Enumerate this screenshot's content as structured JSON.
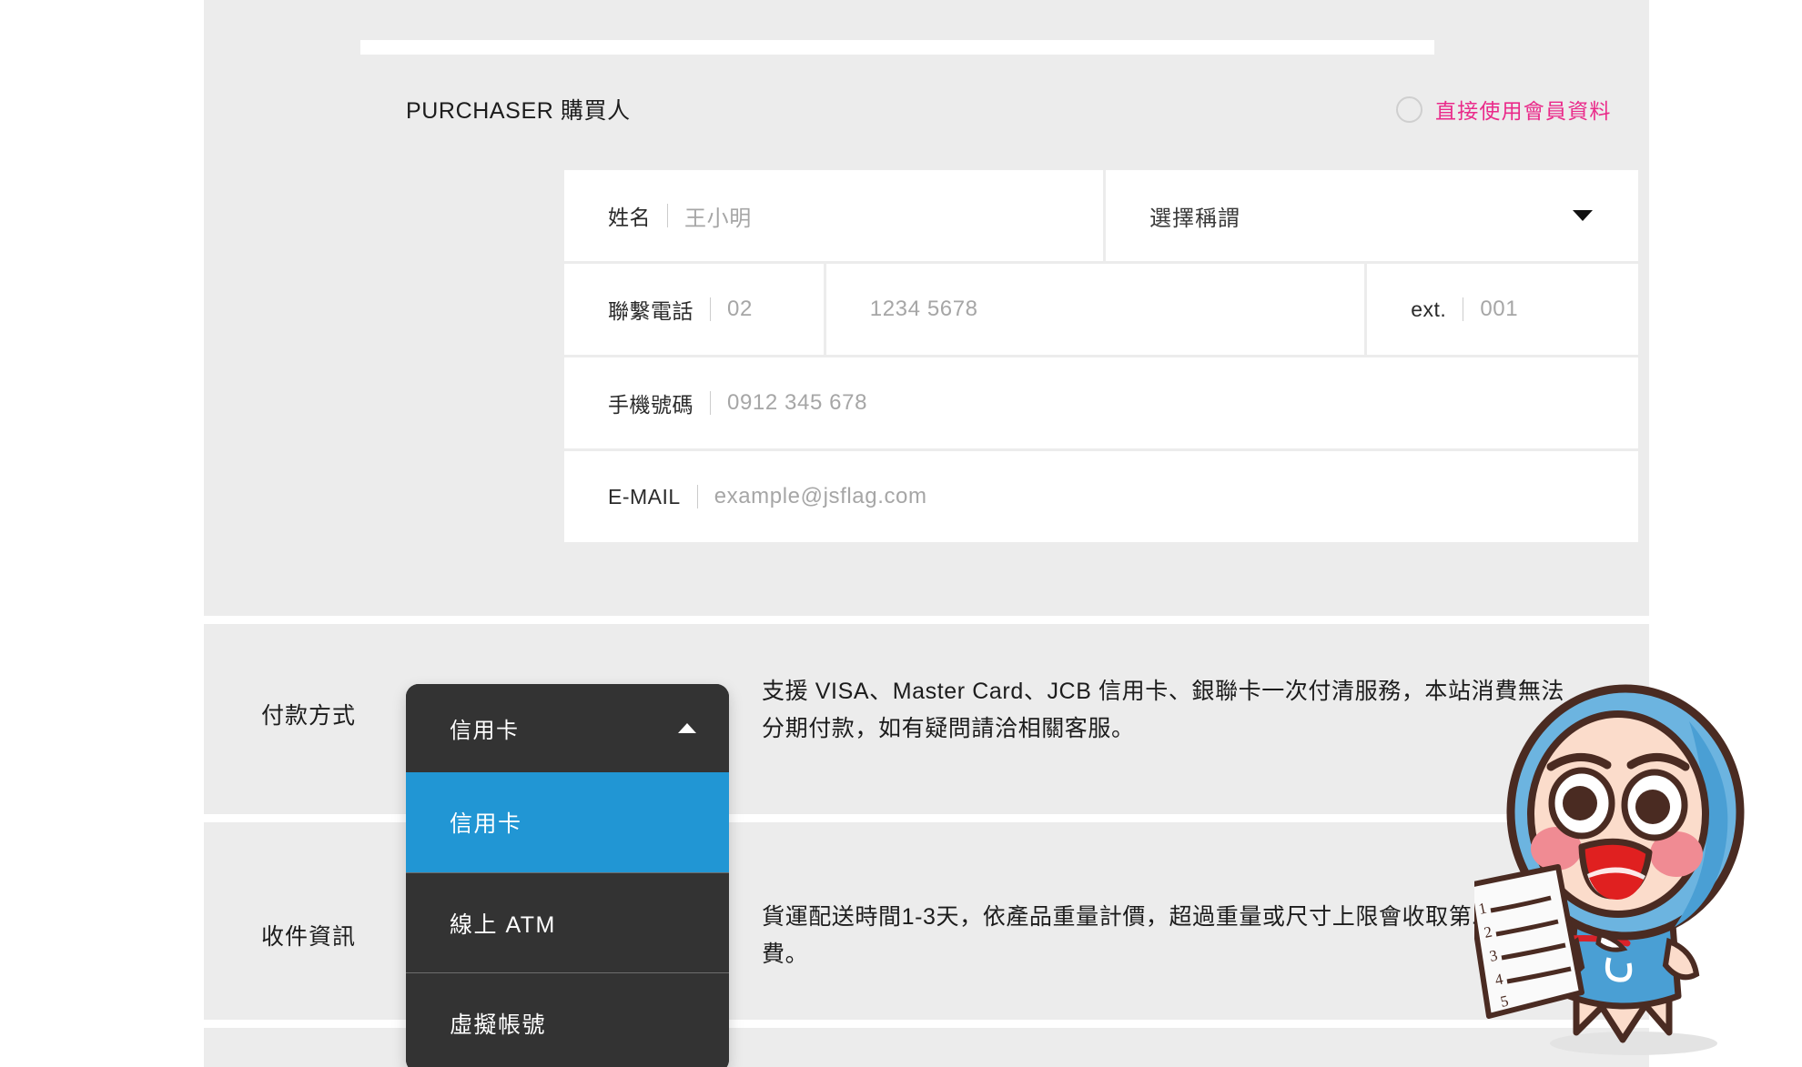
{
  "purchaser": {
    "title": "PURCHASER 購買人",
    "member_toggle": {
      "label": "直接使用會員資料",
      "radio_icon": "radio-unchecked-icon",
      "selected": false,
      "accent_color": "#ea2a8a"
    },
    "fields": {
      "name": {
        "label": "姓名",
        "value": "王小明",
        "placeholder": "王小明"
      },
      "salutation": {
        "label": "選擇稱謂",
        "value": "選擇稱謂",
        "caret_icon": "chevron-down-icon",
        "options": [
          "選擇稱謂"
        ]
      },
      "phone_area": {
        "label": "聯繫電話",
        "value": "02",
        "placeholder": "02"
      },
      "phone_number": {
        "label": "",
        "value": "1234 5678",
        "placeholder": "1234 5678"
      },
      "phone_ext": {
        "label": "ext.",
        "value": "001",
        "placeholder": "001"
      },
      "mobile": {
        "label": "手機號碼",
        "value": "0912 345 678",
        "placeholder": "0912 345 678"
      },
      "email": {
        "label": "E-MAIL",
        "value": "example@jsflag.com",
        "placeholder": "example@jsflag.com"
      }
    }
  },
  "payment": {
    "label": "付款方式",
    "description": "支援 VISA、Master Card、JCB 信用卡、銀聯卡一次付清服務，本站消費無法分期付款，如有疑問請洽相關客服。",
    "dropdown": {
      "selected": "信用卡",
      "open": true,
      "caret_icon": "chevron-up-icon",
      "highlight_color": "#2196d4",
      "menu_color": "#333333",
      "options": [
        {
          "label": "信用卡",
          "selected": true
        },
        {
          "label": "線上 ATM",
          "selected": false
        },
        {
          "label": "虛擬帳號",
          "selected": false
        }
      ]
    }
  },
  "shipping": {
    "label": "收件資訊",
    "description": "貨運配送時間1-3天，依產品重量計價，超過重量或尺寸上限會收取第二筆運費。"
  },
  "indicators": {
    "required_dot_color": "#ea2a8a"
  },
  "mascot": {
    "icon": "mascot-character-icon",
    "description": "卡通客服人員手持清單",
    "hood_color": "#6cb4e0",
    "shirt_color": "#4a9fd4",
    "skin_color": "#fbdccb"
  }
}
